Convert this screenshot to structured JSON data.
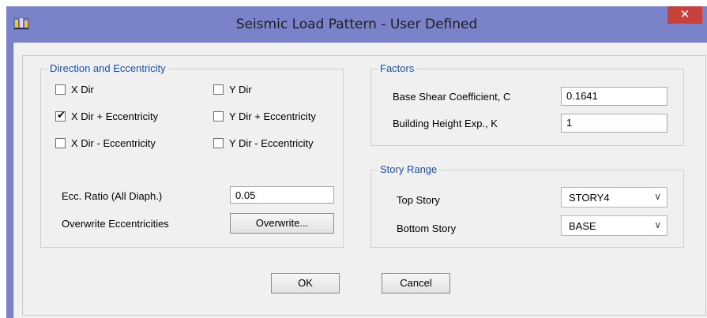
{
  "window": {
    "title": "Seismic Load Pattern - User Defined",
    "close_glyph": "✕"
  },
  "direction": {
    "title": "Direction and Eccentricity",
    "checkboxes": [
      {
        "label": "X Dir",
        "checked": false
      },
      {
        "label": "Y Dir",
        "checked": false
      },
      {
        "label": "X Dir + Eccentricity",
        "checked": true
      },
      {
        "label": "Y Dir + Eccentricity",
        "checked": false
      },
      {
        "label": "X Dir - Eccentricity",
        "checked": false
      },
      {
        "label": "Y Dir - Eccentricity",
        "checked": false
      }
    ],
    "ecc_ratio_label": "Ecc. Ratio (All Diaph.)",
    "ecc_ratio_value": "0.05",
    "overwrite_label": "Overwrite Eccentricities",
    "overwrite_button": "Overwrite..."
  },
  "factors": {
    "title": "Factors",
    "base_shear_label": "Base Shear Coefficient, C",
    "base_shear_value": "0.1641",
    "height_exp_label": "Building Height Exp., K",
    "height_exp_value": "1"
  },
  "story_range": {
    "title": "Story Range",
    "top_label": "Top Story",
    "top_value": "STORY4",
    "bottom_label": "Bottom Story",
    "bottom_value": "BASE"
  },
  "buttons": {
    "ok": "OK",
    "cancel": "Cancel"
  }
}
